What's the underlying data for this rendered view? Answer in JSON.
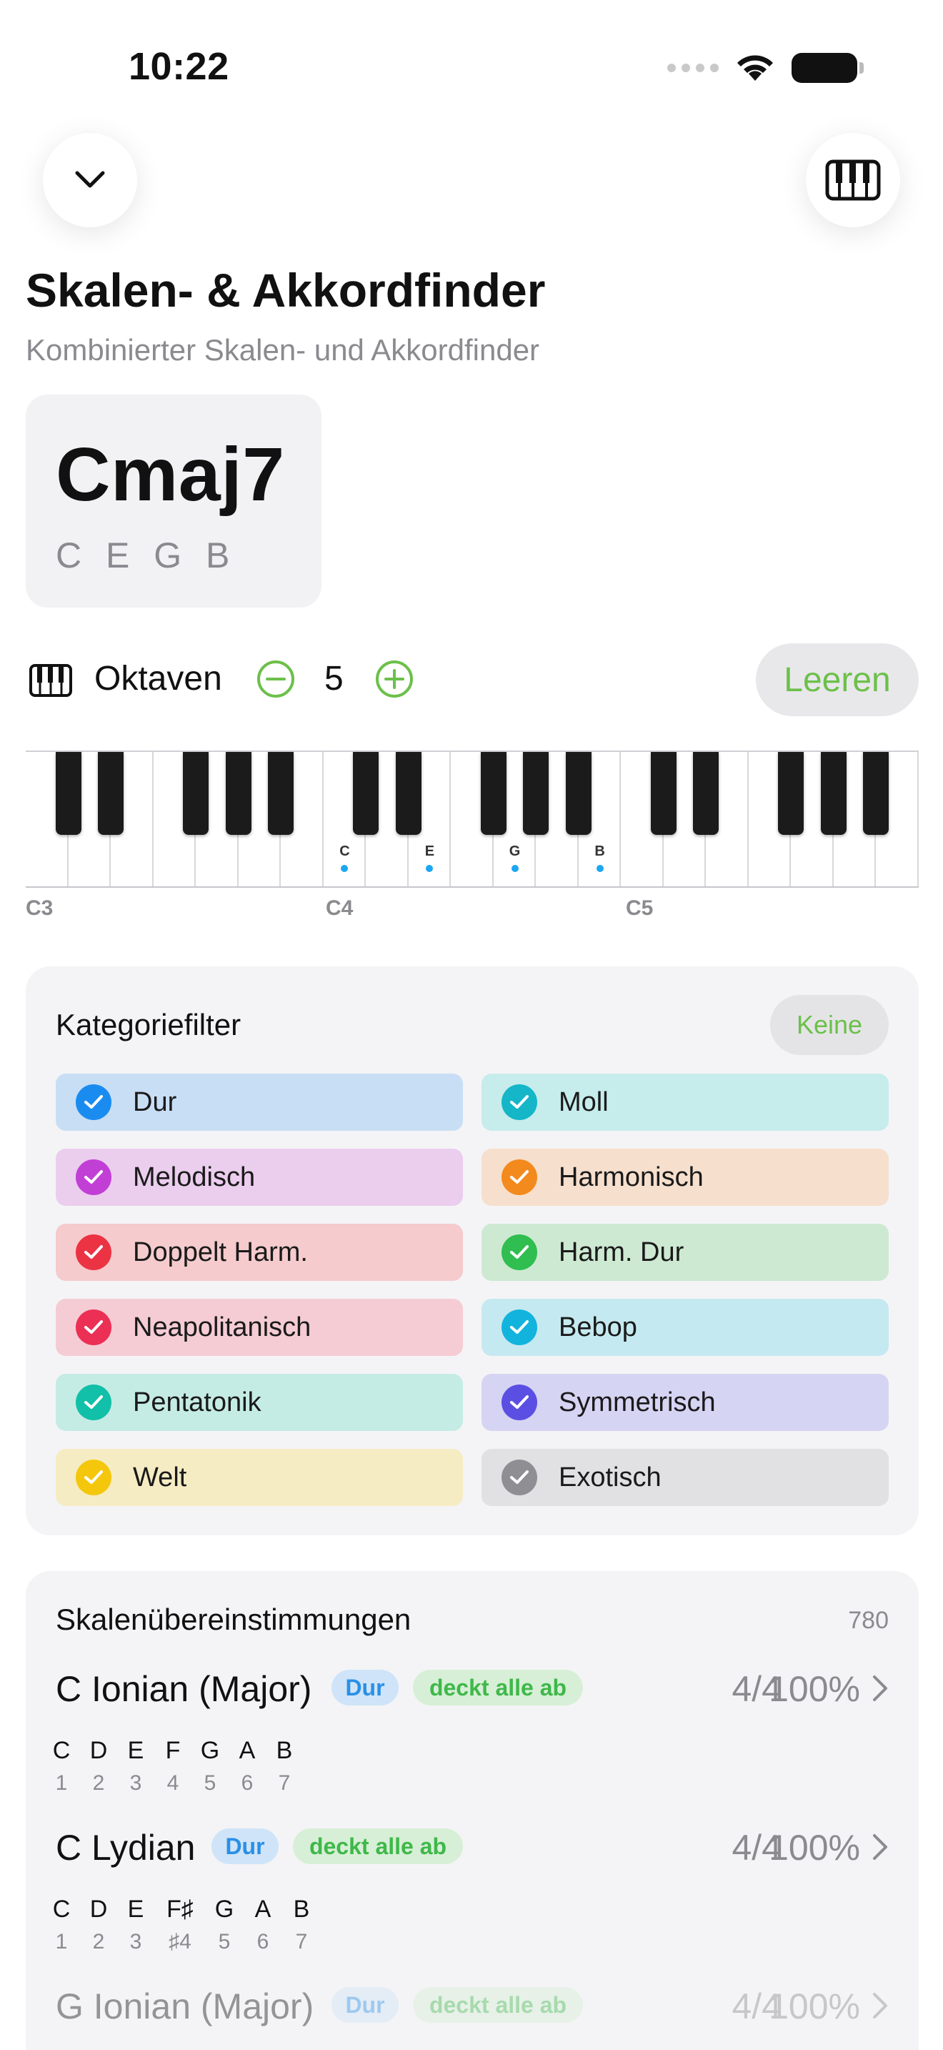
{
  "status": {
    "time": "10:22"
  },
  "header": {
    "title": "Skalen- & Akkordfinder",
    "subtitle": "Kombinierter Skalen- und Akkordfinder"
  },
  "chord": {
    "name": "Cmaj7",
    "notes": "C E G B"
  },
  "octaves": {
    "label": "Oktaven",
    "value": "5",
    "clear_label": "Leeren"
  },
  "keyboard": {
    "octave_marks": [
      "C3",
      "C4",
      "C5"
    ],
    "highlighted": [
      "C",
      "E",
      "G",
      "B"
    ],
    "highlight_color": "#1da6f2"
  },
  "filters": {
    "title": "Kategoriefilter",
    "none_label": "Keine",
    "chips": [
      {
        "label": "Dur",
        "color": "#1a8cf0",
        "bg": "#c8def5"
      },
      {
        "label": "Moll",
        "color": "#14b6c8",
        "bg": "#c6ecec"
      },
      {
        "label": "Melodisch",
        "color": "#c23fd6",
        "bg": "#ebcdee"
      },
      {
        "label": "Harmonisch",
        "color": "#f38a1e",
        "bg": "#f6dfcd"
      },
      {
        "label": "Doppelt Harm.",
        "color": "#ec3344",
        "bg": "#f5cbcd"
      },
      {
        "label": "Harm. Dur",
        "color": "#2fbe4f",
        "bg": "#cde9d2"
      },
      {
        "label": "Neapolitanisch",
        "color": "#ec2f55",
        "bg": "#f5ccd4"
      },
      {
        "label": "Bebop",
        "color": "#12b4dd",
        "bg": "#c5e9f0"
      },
      {
        "label": "Pentatonik",
        "color": "#12bfa8",
        "bg": "#c5ece4"
      },
      {
        "label": "Symmetrisch",
        "color": "#5b4fe3",
        "bg": "#d6d4f3"
      },
      {
        "label": "Welt",
        "color": "#f4c70c",
        "bg": "#f6ecc4"
      },
      {
        "label": "Exotisch",
        "color": "#8e8e93",
        "bg": "#e1e1e3"
      }
    ]
  },
  "matches": {
    "title": "Skalenübereinstimmungen",
    "count": "780",
    "items": [
      {
        "name": "C Ionian (Major)",
        "category": "Dur",
        "coverage": "deckt alle ab",
        "ratio": "4/4",
        "percent": "100%",
        "notes": [
          "C",
          "D",
          "E",
          "F",
          "G",
          "A",
          "B"
        ],
        "degrees": [
          "1",
          "2",
          "3",
          "4",
          "5",
          "6",
          "7"
        ]
      },
      {
        "name": "C Lydian",
        "category": "Dur",
        "coverage": "deckt alle ab",
        "ratio": "4/4",
        "percent": "100%",
        "notes": [
          "C",
          "D",
          "E",
          "F♯",
          "G",
          "A",
          "B"
        ],
        "degrees": [
          "1",
          "2",
          "3",
          "♯4",
          "5",
          "6",
          "7"
        ]
      },
      {
        "name": "G Ionian (Major)",
        "category": "Dur",
        "coverage": "deckt alle ab",
        "ratio": "4/4",
        "percent": "100%"
      }
    ]
  }
}
